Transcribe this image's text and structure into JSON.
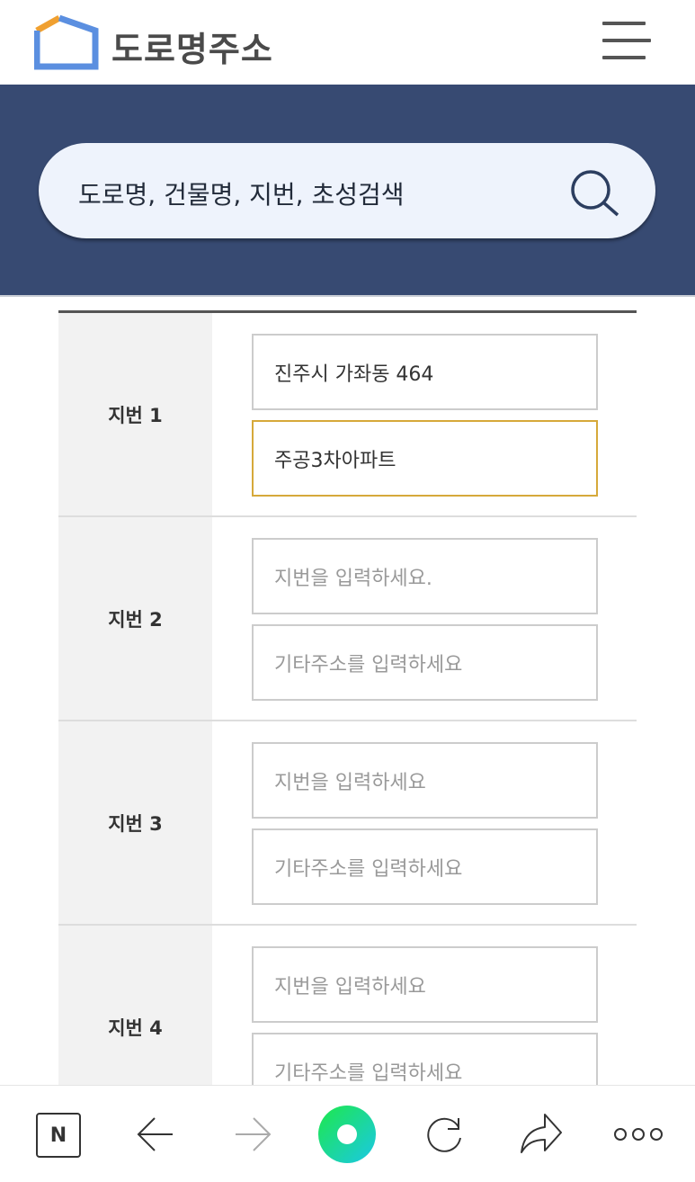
{
  "header": {
    "logo_text": "도로명주소",
    "menu_icon": "hamburger-icon"
  },
  "search": {
    "placeholder": "도로명, 건물명, 지번, 초성검색",
    "icon": "search-icon"
  },
  "rows": [
    {
      "label": "지번 1",
      "jibun": {
        "value": "진주시 가좌동 464",
        "placeholder": ""
      },
      "etc": {
        "value": "주공3차아파트",
        "placeholder": ""
      }
    },
    {
      "label": "지번 2",
      "jibun": {
        "value": "",
        "placeholder": "지번을 입력하세요."
      },
      "etc": {
        "value": "",
        "placeholder": "기타주소를 입력하세요"
      }
    },
    {
      "label": "지번 3",
      "jibun": {
        "value": "",
        "placeholder": "지번을 입력하세요"
      },
      "etc": {
        "value": "",
        "placeholder": "기타주소를 입력하세요"
      }
    },
    {
      "label": "지번 4",
      "jibun": {
        "value": "",
        "placeholder": "지번을 입력하세요"
      },
      "etc": {
        "value": "",
        "placeholder": "기타주소를 입력하세요"
      }
    }
  ],
  "colors": {
    "banner": "#374a72",
    "focus_border": "#d6a93a",
    "logo_orange": "#f0a030",
    "logo_blue": "#5b8fe0"
  },
  "bottom_bar": {
    "icons": [
      "naver-n-icon",
      "back-arrow-icon",
      "forward-arrow-icon",
      "green-dot-icon",
      "reload-icon",
      "share-icon",
      "more-icon"
    ],
    "n_label": "N"
  }
}
